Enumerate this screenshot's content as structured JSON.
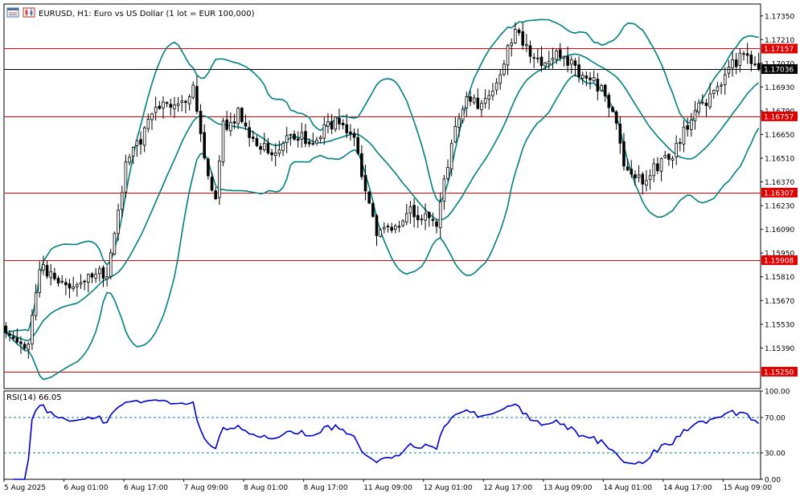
{
  "header": {
    "title": "EURUSD, H1:  Euro vs US Dollar (1 lot = EUR 100,000)",
    "icons": [
      "chart-window-icon",
      "candle-chart-icon"
    ]
  },
  "colors": {
    "background": "#ffffff",
    "candle": "#000000",
    "bollinger": "#008080",
    "hline": "#e00000",
    "price_line": "#000000",
    "rsi_line": "#0000cd",
    "rsi_levels": "#008080",
    "frame": "#000000",
    "axis_text": "#000000"
  },
  "price_axis": {
    "ylim": [
      1.1515,
      1.1742
    ],
    "ticks": [
      "1.17350",
      "1.17210",
      "1.17070",
      "1.16930",
      "1.16790",
      "1.16650",
      "1.16510",
      "1.16370",
      "1.16230",
      "1.16090",
      "1.15950",
      "1.15810",
      "1.15670",
      "1.15530",
      "1.15390"
    ],
    "tick_values": [
      1.1735,
      1.1721,
      1.1707,
      1.1693,
      1.1679,
      1.1665,
      1.1651,
      1.1637,
      1.1623,
      1.1609,
      1.1595,
      1.1581,
      1.1567,
      1.1553,
      1.1539
    ]
  },
  "horizontal_lines": [
    {
      "value": 1.17157,
      "label": "1.17157"
    },
    {
      "value": 1.16757,
      "label": "1.16757"
    },
    {
      "value": 1.16307,
      "label": "1.16307"
    },
    {
      "value": 1.15908,
      "label": "1.15908"
    },
    {
      "value": 1.1525,
      "label": "1.15250"
    }
  ],
  "current_price": {
    "value": 1.17036,
    "label": "1.17036"
  },
  "time_axis": {
    "labels": [
      "5 Aug 2025",
      "6 Aug 01:00",
      "6 Aug 17:00",
      "7 Aug 09:00",
      "8 Aug 01:00",
      "8 Aug 17:00",
      "11 Aug 09:00",
      "12 Aug 01:00",
      "12 Aug 17:00",
      "13 Aug 09:00",
      "14 Aug 01:00",
      "14 Aug 17:00",
      "15 Aug 09:00"
    ],
    "label_bar_index": [
      0,
      16,
      32,
      48,
      64,
      80,
      96,
      112,
      128,
      144,
      160,
      176,
      192
    ]
  },
  "rsi": {
    "label": "RSI(14) 66.05",
    "period": 14,
    "ylim": [
      0,
      100
    ],
    "ticks": [
      "100.00",
      "70.00",
      "30.00",
      "0.00"
    ],
    "tick_values": [
      100,
      70,
      30,
      0
    ],
    "levels": [
      70,
      30
    ]
  },
  "chart_data": [
    {
      "type": "candlestick",
      "symbol": "EURUSD",
      "timeframe": "H1",
      "title": "EURUSD, H1:  Euro vs US Dollar (1 lot = EUR 100,000)",
      "ylim": [
        1.1515,
        1.1742
      ],
      "bar_count": 202,
      "anchors": {
        "bar_index": [
          0,
          6,
          9,
          15,
          20,
          27,
          32,
          40,
          46,
          50,
          53,
          56,
          58,
          62,
          65,
          72,
          76,
          81,
          88,
          93,
          97,
          99,
          104,
          108,
          115,
          117,
          120,
          124,
          126,
          128,
          131,
          136,
          140,
          144,
          148,
          152,
          155,
          160,
          163,
          166,
          170,
          175,
          178,
          185,
          188,
          191,
          196,
          199,
          201
        ],
        "close": [
          1.1548,
          1.1541,
          1.1586,
          1.1577,
          1.158,
          1.1584,
          1.1645,
          1.1681,
          1.1683,
          1.1691,
          1.1652,
          1.1627,
          1.1669,
          1.1677,
          1.1663,
          1.1652,
          1.1667,
          1.1661,
          1.1674,
          1.1662,
          1.1621,
          1.1609,
          1.1611,
          1.1619,
          1.1612,
          1.1636,
          1.1672,
          1.1688,
          1.1679,
          1.1683,
          1.1696,
          1.1728,
          1.1712,
          1.1706,
          1.1712,
          1.1703,
          1.1701,
          1.1688,
          1.1668,
          1.1641,
          1.1636,
          1.1649,
          1.1654,
          1.1682,
          1.1686,
          1.1695,
          1.1712,
          1.1706,
          1.17036
        ]
      },
      "bollinger": {
        "period": 20,
        "deviations": 2
      }
    },
    {
      "type": "line",
      "name": "RSI(14) 66.05",
      "ylim": [
        0,
        100
      ]
    }
  ]
}
